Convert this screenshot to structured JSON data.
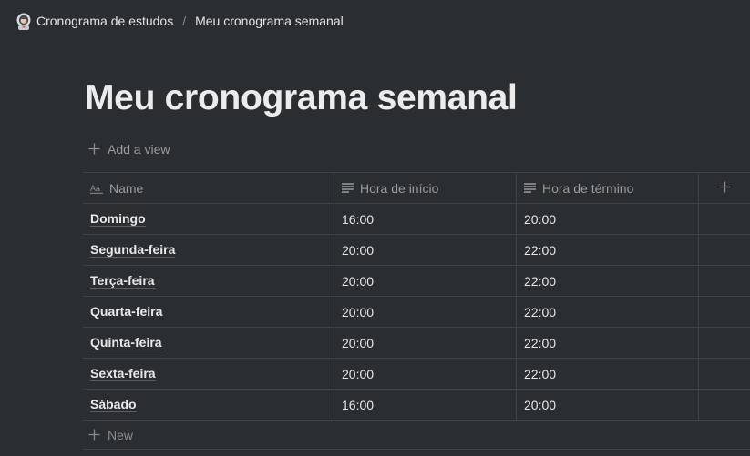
{
  "breadcrumb": {
    "parent_icon": "astronaut-emoji-icon",
    "parent_label": "Cronograma de estudos",
    "separator": "/",
    "current_label": "Meu cronograma semanal"
  },
  "page": {
    "title": "Meu cronograma semanal"
  },
  "toolbar": {
    "add_view_label": "Add a view"
  },
  "table": {
    "columns": [
      {
        "label": "Name",
        "icon": "title-property-icon"
      },
      {
        "label": "Hora de início",
        "icon": "text-property-icon"
      },
      {
        "label": "Hora de término",
        "icon": "text-property-icon"
      }
    ],
    "add_column_icon": "plus-icon",
    "rows": [
      {
        "name": "Domingo",
        "start": "16:00",
        "end": "20:00"
      },
      {
        "name": "Segunda-feira",
        "start": "20:00",
        "end": "22:00"
      },
      {
        "name": "Terça-feira",
        "start": "20:00",
        "end": "22:00"
      },
      {
        "name": "Quarta-feira",
        "start": "20:00",
        "end": "22:00"
      },
      {
        "name": "Quinta-feira",
        "start": "20:00",
        "end": "22:00"
      },
      {
        "name": "Sexta-feira",
        "start": "20:00",
        "end": "22:00"
      },
      {
        "name": "Sábado",
        "start": "16:00",
        "end": "20:00"
      }
    ],
    "new_label": "New"
  }
}
